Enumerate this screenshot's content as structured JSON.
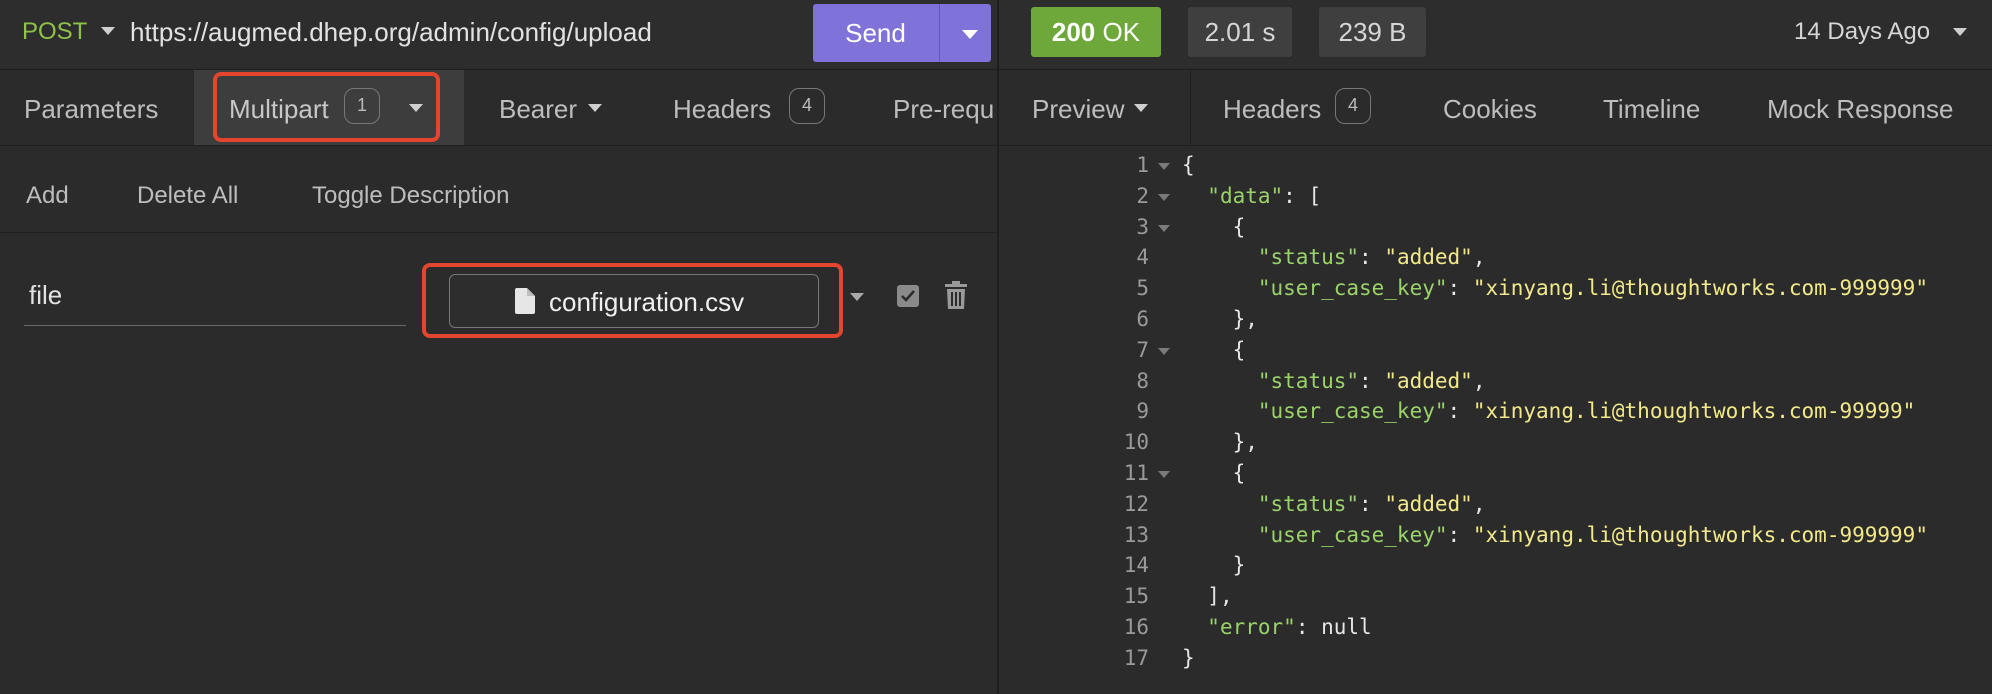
{
  "request": {
    "method": "POST",
    "url": "https://augmed.dhep.org/admin/config/upload",
    "send_label": "Send",
    "tabs": [
      {
        "label": "Parameters"
      },
      {
        "label": "Multipart",
        "badge": "1"
      },
      {
        "label": "Bearer"
      },
      {
        "label": "Headers",
        "badge": "4"
      },
      {
        "label": "Pre-requ"
      }
    ],
    "actions": {
      "add": "Add",
      "delete_all": "Delete All",
      "toggle_description": "Toggle Description"
    },
    "field": {
      "name": "file",
      "file": "configuration.csv"
    }
  },
  "response": {
    "status": {
      "code": "200",
      "text": "OK"
    },
    "time": "2.01 s",
    "size": "239 B",
    "history": "14 Days Ago",
    "tabs": [
      {
        "label": "Preview"
      },
      {
        "label": "Headers",
        "badge": "4"
      },
      {
        "label": "Cookies"
      },
      {
        "label": "Timeline"
      },
      {
        "label": "Mock Response"
      }
    ],
    "body_lines": [
      {
        "n": "1",
        "fold": true,
        "indent": "",
        "parts": [
          [
            "p",
            "{"
          ]
        ]
      },
      {
        "n": "2",
        "fold": true,
        "indent": "  ",
        "parts": [
          [
            "k",
            "\"data\""
          ],
          [
            "p",
            ": ["
          ]
        ]
      },
      {
        "n": "3",
        "fold": true,
        "indent": "    ",
        "parts": [
          [
            "p",
            "{"
          ]
        ]
      },
      {
        "n": "4",
        "fold": false,
        "indent": "      ",
        "parts": [
          [
            "k",
            "\"status\""
          ],
          [
            "p",
            ": "
          ],
          [
            "s",
            "\"added\""
          ],
          [
            "p",
            ","
          ]
        ]
      },
      {
        "n": "5",
        "fold": false,
        "indent": "      ",
        "parts": [
          [
            "k",
            "\"user_case_key\""
          ],
          [
            "p",
            ": "
          ],
          [
            "s",
            "\"xinyang.li@thoughtworks.com-999999\""
          ]
        ]
      },
      {
        "n": "6",
        "fold": false,
        "indent": "    ",
        "parts": [
          [
            "p",
            "},"
          ]
        ]
      },
      {
        "n": "7",
        "fold": true,
        "indent": "    ",
        "parts": [
          [
            "p",
            "{"
          ]
        ]
      },
      {
        "n": "8",
        "fold": false,
        "indent": "      ",
        "parts": [
          [
            "k",
            "\"status\""
          ],
          [
            "p",
            ": "
          ],
          [
            "s",
            "\"added\""
          ],
          [
            "p",
            ","
          ]
        ]
      },
      {
        "n": "9",
        "fold": false,
        "indent": "      ",
        "parts": [
          [
            "k",
            "\"user_case_key\""
          ],
          [
            "p",
            ": "
          ],
          [
            "s",
            "\"xinyang.li@thoughtworks.com-99999\""
          ]
        ]
      },
      {
        "n": "10",
        "fold": false,
        "indent": "    ",
        "parts": [
          [
            "p",
            "},"
          ]
        ]
      },
      {
        "n": "11",
        "fold": true,
        "indent": "    ",
        "parts": [
          [
            "p",
            "{"
          ]
        ]
      },
      {
        "n": "12",
        "fold": false,
        "indent": "      ",
        "parts": [
          [
            "k",
            "\"status\""
          ],
          [
            "p",
            ": "
          ],
          [
            "s",
            "\"added\""
          ],
          [
            "p",
            ","
          ]
        ]
      },
      {
        "n": "13",
        "fold": false,
        "indent": "      ",
        "parts": [
          [
            "k",
            "\"user_case_key\""
          ],
          [
            "p",
            ": "
          ],
          [
            "s",
            "\"xinyang.li@thoughtworks.com-999999\""
          ]
        ]
      },
      {
        "n": "14",
        "fold": false,
        "indent": "    ",
        "parts": [
          [
            "p",
            "}"
          ]
        ]
      },
      {
        "n": "15",
        "fold": false,
        "indent": "  ",
        "parts": [
          [
            "p",
            "],"
          ]
        ]
      },
      {
        "n": "16",
        "fold": false,
        "indent": "  ",
        "parts": [
          [
            "k",
            "\"error\""
          ],
          [
            "p",
            ": "
          ],
          [
            "n",
            "null"
          ]
        ]
      },
      {
        "n": "17",
        "fold": false,
        "indent": "",
        "parts": [
          [
            "p",
            "}"
          ]
        ]
      }
    ]
  },
  "colors": {
    "send_button": "#7f72d8",
    "status_ok": "#6ea83a",
    "method": "#8fc24a",
    "highlight_box": "#e3452f",
    "json_key": "#9ad36a",
    "json_string": "#f2e98b"
  }
}
